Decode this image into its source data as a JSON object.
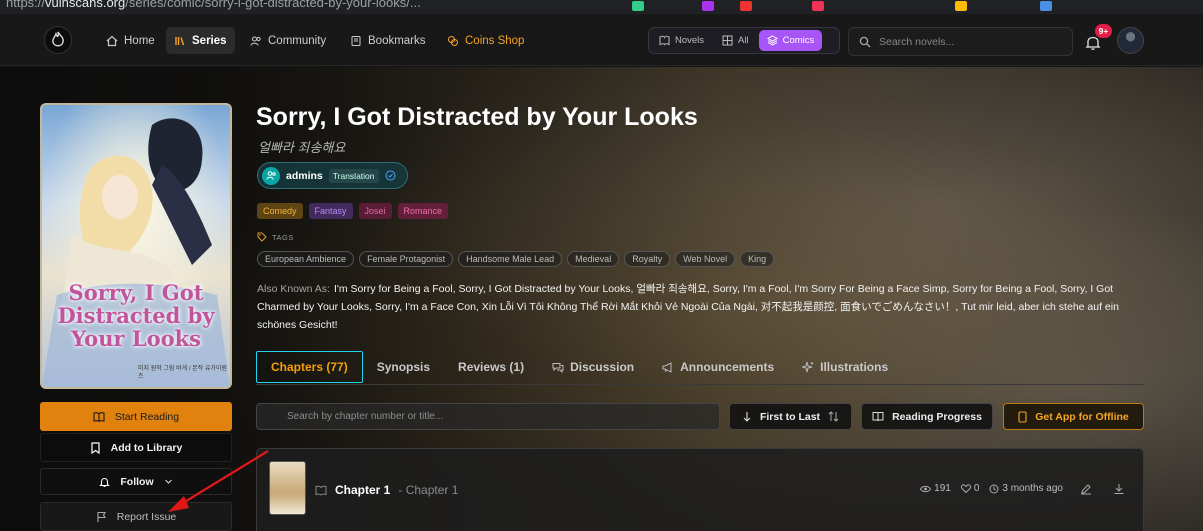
{
  "browser": {
    "url_prefix": "https://",
    "url_domain": "vulnscans.org",
    "url_path": "/series/comic/sorry-i-got-distracted-by-your-looks/..."
  },
  "nav": {
    "items": [
      {
        "label": "Home",
        "icon": "home-icon"
      },
      {
        "label": "Series",
        "icon": "books-icon",
        "active": true
      },
      {
        "label": "Community",
        "icon": "users-icon"
      },
      {
        "label": "Bookmarks",
        "icon": "bookmark-icon"
      },
      {
        "label": "Coins Shop",
        "icon": "coins-icon"
      }
    ],
    "filters": [
      {
        "label": "Novels",
        "icon": "book-icon"
      },
      {
        "label": "All",
        "icon": "grid-icon"
      },
      {
        "label": "Comics",
        "icon": "layers-icon",
        "active": true
      }
    ],
    "search_placeholder": "Search novels...",
    "notification_count": "9+"
  },
  "series": {
    "title": "Sorry, I Got Distracted by Your Looks",
    "alt_title": "얼빠라 죄송해요",
    "cover_title": "Sorry, I Got Distracted by Your Looks",
    "cover_credits": "미지 원작 그림 바게 / 본작 유가이원즈",
    "team": {
      "name": "admins",
      "role": "Translation"
    },
    "genres": [
      {
        "label": "Comedy",
        "color": "#f5b335",
        "bg": "rgba(120,85,20,0.75)"
      },
      {
        "label": "Fantasy",
        "color": "#b98cf0",
        "bg": "rgba(80,50,120,0.75)"
      },
      {
        "label": "Josei",
        "color": "#e06c9f",
        "bg": "rgba(110,30,65,0.75)"
      },
      {
        "label": "Romance",
        "color": "#ef6fa7",
        "bg": "rgba(120,30,70,0.75)"
      }
    ],
    "tags_label": "TAGS",
    "tags": [
      "European Ambience",
      "Female Protagonist",
      "Handsome Male Lead",
      "Medieval",
      "Royalty",
      "Web Novel",
      "King"
    ],
    "aka_label": "Also Known As:",
    "aka_text": "I'm Sorry for Being a Fool, Sorry, I Got Distracted by Your Looks, 얼빠라 죄송해요, Sorry, I'm a Fool, I'm Sorry For Being a Face Simp, Sorry for Being a Fool, Sorry, I Got Charmed by Your Looks, Sorry, I'm a Face Con, Xin Lỗi Vì Tôi Không Thể Rời Mắt Khỏi Vẻ Ngoài Của Ngài, 对不起我是颜控, 面食いでごめんなさい！, Tut mir leid, aber ich stehe auf ein schönes Gesicht!"
  },
  "actions": {
    "start": "Start Reading",
    "library": "Add to Library",
    "follow": "Follow",
    "report": "Report Issue"
  },
  "tabs": [
    {
      "label": "Chapters (77)",
      "active": true
    },
    {
      "label": "Synopsis"
    },
    {
      "label": "Reviews (1)"
    },
    {
      "label": "Discussion",
      "icon": "chat-icon"
    },
    {
      "label": "Announcements",
      "icon": "megaphone-icon"
    },
    {
      "label": "Illustrations",
      "icon": "sparkles-icon"
    }
  ],
  "chapters_toolbar": {
    "search_placeholder": "Search by chapter number or title...",
    "sort": "First to Last",
    "progress": "Reading Progress",
    "app": "Get App for Offline"
  },
  "chapter_list": [
    {
      "title": "Chapter 1",
      "subtitle": "- Chapter 1",
      "views": "191",
      "likes": "0",
      "time": "3 months ago"
    }
  ]
}
